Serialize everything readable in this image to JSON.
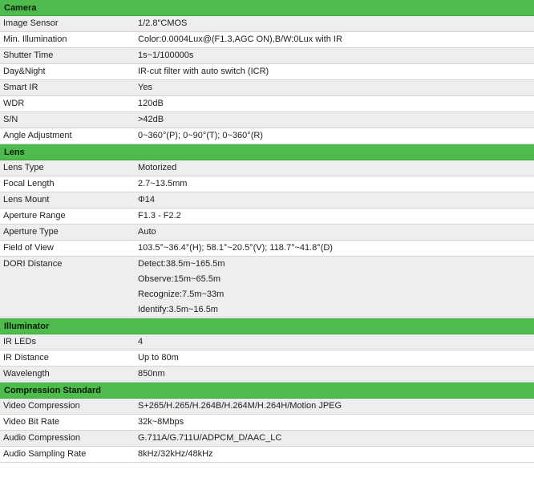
{
  "sections": [
    {
      "title": "Camera",
      "rows": [
        {
          "key": "Image Sensor",
          "values": [
            "1/2.8\"CMOS"
          ]
        },
        {
          "key": "Min. Illumination",
          "values": [
            "Color:0.0004Lux@(F1.3,AGC ON),B/W:0Lux with IR"
          ]
        },
        {
          "key": "Shutter Time",
          "values": [
            "1s~1/100000s"
          ]
        },
        {
          "key": "Day&Night",
          "values": [
            "IR-cut filter with auto switch (ICR)"
          ]
        },
        {
          "key": "Smart IR",
          "values": [
            "Yes"
          ]
        },
        {
          "key": "WDR",
          "values": [
            "120dB"
          ]
        },
        {
          "key": "S/N",
          "values": [
            ">42dB"
          ]
        },
        {
          "key": "Angle Adjustment",
          "values": [
            "0~360°(P); 0~90°(T); 0~360°(R)"
          ]
        }
      ]
    },
    {
      "title": "Lens",
      "rows": [
        {
          "key": "Lens Type",
          "values": [
            "Motorized"
          ]
        },
        {
          "key": "Focal Length",
          "values": [
            "2.7~13.5mm"
          ]
        },
        {
          "key": "Lens Mount",
          "values": [
            "Φ14"
          ]
        },
        {
          "key": "Aperture Range",
          "values": [
            "F1.3 - F2.2"
          ]
        },
        {
          "key": "Aperture Type",
          "values": [
            "Auto"
          ]
        },
        {
          "key": "Field of View",
          "values": [
            "103.5°~36.4°(H); 58.1°~20.5°(V); 118.7°~41.8°(D)"
          ]
        },
        {
          "key": "DORI Distance",
          "values": [
            "Detect:38.5m~165.5m",
            "Observe:15m~65.5m",
            "Recognize:7.5m~33m",
            "Identify:3.5m~16.5m"
          ]
        }
      ]
    },
    {
      "title": "Illuminator",
      "rows": [
        {
          "key": "IR LEDs",
          "values": [
            "4"
          ]
        },
        {
          "key": "IR Distance",
          "values": [
            "Up to 80m"
          ]
        },
        {
          "key": "Wavelength",
          "values": [
            "850nm"
          ]
        }
      ]
    },
    {
      "title": "Compression Standard",
      "rows": [
        {
          "key": "Video Compression",
          "values": [
            "S+265/H.265/H.264B/H.264M/H.264H/Motion JPEG"
          ]
        },
        {
          "key": "Video Bit Rate",
          "values": [
            "32k~8Mbps"
          ]
        },
        {
          "key": "Audio Compression",
          "values": [
            "G.711A/G.711U/ADPCM_D/AAC_LC"
          ]
        },
        {
          "key": "Audio Sampling Rate",
          "values": [
            "8kHz/32kHz/48kHz"
          ]
        }
      ]
    }
  ]
}
